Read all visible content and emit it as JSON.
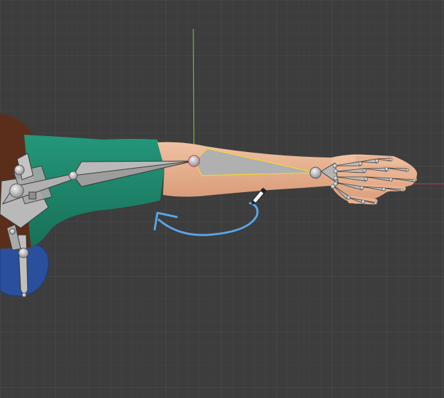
{
  "viewport": {
    "background": "#3d3d3d",
    "grid_minor_color": "#454545",
    "grid_major_color": "#4e4e4e",
    "x_axis_color": "#c0394a",
    "y_axis_color": "#6fc13a"
  },
  "scene": {
    "skin_color": "#e8b18f",
    "sleeve_color": "#1f8a6a",
    "hair_color": "#5a2e1a",
    "pants_color": "#2a4f9c",
    "bone_color": "#b9b9b9",
    "active_bone_outline": "#f0d43a",
    "joint_color": "#d8d8d8",
    "annotation_arrow_color": "#5aa6e8",
    "pen_cursor_icon": "pen-cursor-icon"
  }
}
